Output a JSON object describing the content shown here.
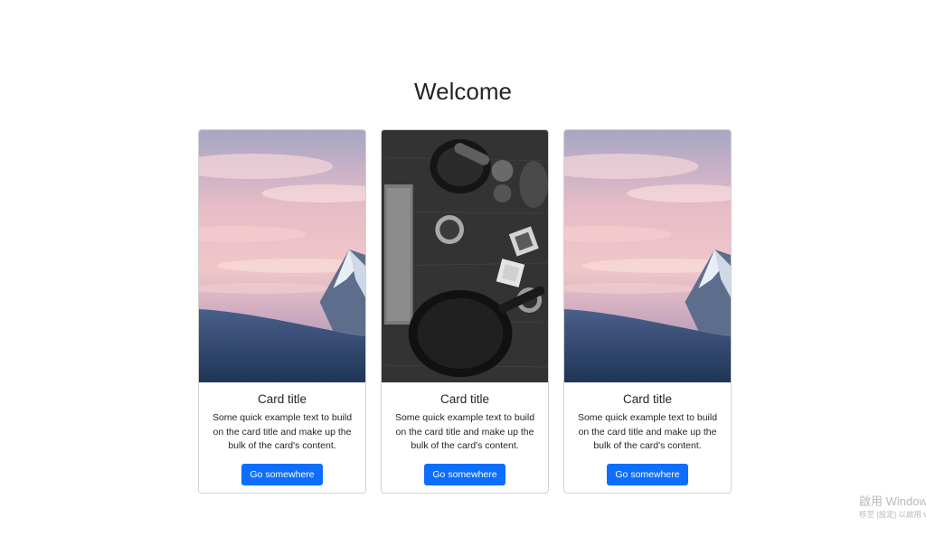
{
  "header": {
    "title": "Welcome"
  },
  "cards": [
    {
      "image": "mountain-sunset-photo",
      "title": "Card title",
      "text": "Some quick example text to build on the card title and make up the bulk of the card's content.",
      "button": "Go somewhere"
    },
    {
      "image": "kitchen-bowls-photo",
      "title": "Card title",
      "text": "Some quick example text to build on the card title and make up the bulk of the card's content.",
      "button": "Go somewhere"
    },
    {
      "image": "mountain-sunset-photo",
      "title": "Card title",
      "text": "Some quick example text to build on the card title and make up the bulk of the card's content.",
      "button": "Go somewhere"
    }
  ],
  "watermark": {
    "line1": "啟用 Windows",
    "line2": "移至 [設定] 以啟用 Windows。"
  },
  "colors": {
    "button": "#0d6efd",
    "text": "#212529",
    "background": "#ffffff"
  }
}
